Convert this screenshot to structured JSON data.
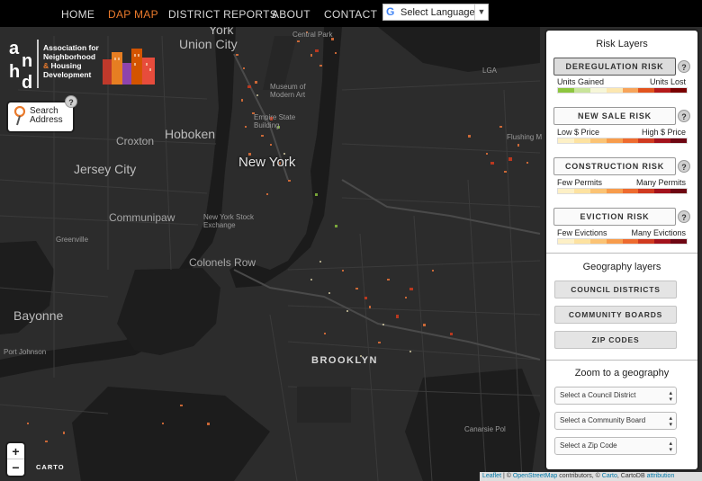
{
  "nav": {
    "items": [
      "HOME",
      "DAP MAP",
      "DISTRICT REPORTS",
      "ABOUT",
      "CONTACT"
    ],
    "active": "DAP MAP",
    "language_label": "Select Language",
    "language_arrow": "▼"
  },
  "logo": {
    "mark": "anhd",
    "line1": "Association for",
    "line2": "Neighborhood",
    "line3_amp": "&",
    "line3": "Housing",
    "line4": "Development"
  },
  "search": {
    "line1": "Search",
    "line2": "Address",
    "help": "?"
  },
  "map_labels": [
    "York",
    "Union City",
    "Central Park",
    "LGA",
    "Museum of Modern Art",
    "Empire State Building",
    "Hoboken",
    "Croxton",
    "Jersey City",
    "New York",
    "Communipaw",
    "New York Stock Exchange",
    "Greenville",
    "Colonels Row",
    "Bayonne",
    "Port Johnson",
    "Flushing M",
    "BROOKLYN",
    "Canarsie Pol"
  ],
  "panel": {
    "risk_title": "Risk Layers",
    "risk_layers": [
      {
        "label": "DEREGULATION RISK",
        "low": "Units Gained",
        "high": "Units Lost",
        "active": true,
        "colors": [
          "#8dc63f",
          "#c9e49b",
          "#f6f6d8",
          "#fce7b0",
          "#f7a45a",
          "#e2541e",
          "#b51a1a",
          "#7a0000"
        ]
      },
      {
        "label": "NEW SALE RISK",
        "low": "Low $ Price",
        "high": "High $ Price",
        "active": false,
        "colors": [
          "#fdf0c6",
          "#fde2a0",
          "#fbc374",
          "#f79c4c",
          "#ee6b2f",
          "#d03a20",
          "#a3121c",
          "#6e0612"
        ]
      },
      {
        "label": "CONSTRUCTION RISK",
        "low": "Few Permits",
        "high": "Many Permits",
        "active": false,
        "colors": [
          "#fdf0c6",
          "#fde2a0",
          "#fbc374",
          "#f79c4c",
          "#ee6b2f",
          "#d03a20",
          "#a3121c",
          "#6e0612"
        ]
      },
      {
        "label": "EVICTION RISK",
        "low": "Few Evictions",
        "high": "Many Evictions",
        "active": false,
        "colors": [
          "#fdf0c6",
          "#fde2a0",
          "#fbc374",
          "#f79c4c",
          "#ee6b2f",
          "#d03a20",
          "#a3121c",
          "#6e0612"
        ]
      }
    ],
    "help": "?",
    "geo_title": "Geography layers",
    "geo_buttons": [
      "COUNCIL DISTRICTS",
      "COMMUNITY BOARDS",
      "ZIP CODES"
    ],
    "zoom_title": "Zoom to a geography",
    "selects": [
      "Select a Council District",
      "Select a Community Board",
      "Select a Zip Code"
    ]
  },
  "zoom": {
    "in": "+",
    "out": "−"
  },
  "carto_label": "CARTO",
  "attribution": {
    "leaflet": "Leaflet",
    "sep1": " | © ",
    "osm": "OpenStreetMap",
    "mid": " contributors, © ",
    "carto": "Carto",
    "cartodb": ", CartoDB ",
    "attr": "attribution"
  },
  "colors": {
    "accent": "#e97a2c",
    "map_bg": "#2b2b2b",
    "water": "#1b1b1b"
  }
}
